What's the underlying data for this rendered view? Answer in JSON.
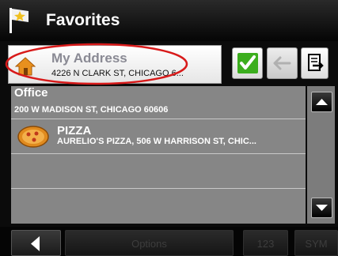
{
  "header": {
    "title": "Favorites",
    "icon": "favorites-flag-icon"
  },
  "address_bar": {
    "icon": "house-icon",
    "name": "My Address",
    "line": "4226 N CLARK ST, CHICAGO 6...",
    "highlight_color": "#d81a1a"
  },
  "toolbar": {
    "confirm_icon": "check-icon",
    "backspace_icon": "backspace-arrow-icon",
    "keyboard_icon": "keyboard-icon"
  },
  "favorites": [
    {
      "name": "Office",
      "address": "200 W MADISON ST, CHICAGO 60606"
    },
    {
      "name": "PIZZA",
      "address": "AURELIO'S PIZZA, 506 W HARRISON ST, CHIC...",
      "icon": "pizza-icon"
    }
  ],
  "bottom_bar": {
    "back_icon": "back-arrow-icon",
    "options_label": "Options",
    "num_label": "123",
    "sym_label": "SYM"
  },
  "colors": {
    "list_bg": "#868686",
    "check_green": "#3cae1e",
    "accent_red": "#d81a1a"
  }
}
